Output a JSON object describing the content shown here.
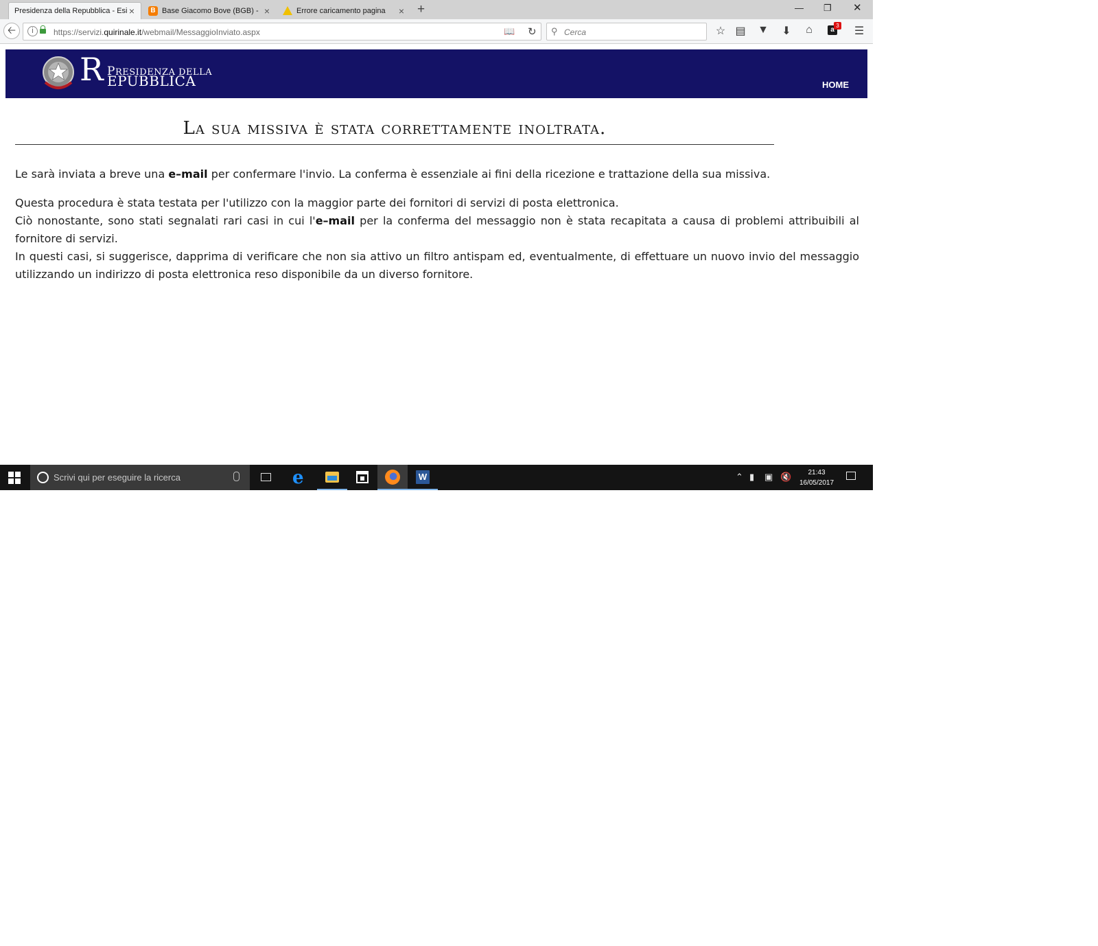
{
  "browser": {
    "tabs": [
      {
        "title": "Presidenza della Repubblica - Esi",
        "active": true
      },
      {
        "title": "Base Giacomo Bove (BGB) -",
        "active": false,
        "favicon": "blogger-icon"
      },
      {
        "title": "Errore caricamento pagina",
        "active": false,
        "favicon": "warning-icon"
      }
    ],
    "url_prefix": "https://servizi.",
    "url_domain": "quirinale.it",
    "url_path": "/webmail/MessaggioInviato.aspx",
    "search_placeholder": "Cerca",
    "amazon_badge": "3"
  },
  "site": {
    "logo_initial_r": "R",
    "logo_initial_p": "P",
    "logo_line1": "RESIDENZA DELLA",
    "logo_line2": "EPUBBLICA",
    "nav_home": "HOME",
    "title": "La sua missiva è stata correttamente inoltrata.",
    "para1_a": "Le sarà inviata a breve una ",
    "para1_b": "e–mail",
    "para1_c": " per confermare l'invio. La conferma è essenziale ai fini della ricezione e trattazione della sua missiva.",
    "para2_line1": "Questa procedura è stata testata per l'utilizzo con la maggior parte dei fornitori di servizi di posta elettronica.",
    "para2_line2_a": "Ciò nonostante, sono stati segnalati rari casi in cui l'",
    "para2_line2_b": "e–mail",
    "para2_line2_c": " per la conferma del messaggio non è stata recapitata a causa di problemi attribuibili al fornitore di servizi.",
    "para2_line3": "In questi casi, si suggerisce, dapprima di verificare che non sia attivo un filtro antispam ed, eventualmente, di effettuare un nuovo invio del messaggio utilizzando un indirizzo di posta elettronica reso disponibile da un diverso fornitore."
  },
  "taskbar": {
    "search_placeholder": "Scrivi qui per eseguire la ricerca",
    "time": "21:43",
    "date": "16/05/2017",
    "word_letter": "W"
  },
  "colors": {
    "header_bg": "#141266",
    "taskbar_bg": "#141414"
  }
}
